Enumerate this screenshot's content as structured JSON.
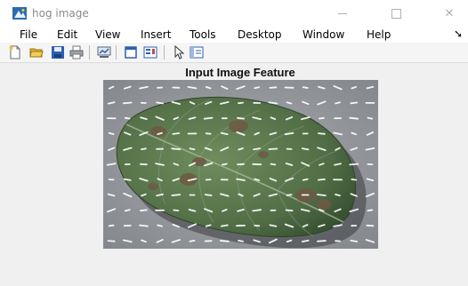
{
  "window": {
    "title": "hog image",
    "controls": {
      "minimize": "—",
      "maximize": "☐",
      "close": "✕"
    }
  },
  "menu": {
    "items": [
      {
        "label": "File"
      },
      {
        "label": "Edit"
      },
      {
        "label": "View"
      },
      {
        "label": "Insert"
      },
      {
        "label": "Tools"
      },
      {
        "label": "Desktop"
      },
      {
        "label": "Window"
      },
      {
        "label": "Help"
      }
    ],
    "overflow_arrow": "➘"
  },
  "toolbar": {
    "buttons": [
      "new-figure-icon",
      "open-file-icon",
      "save-icon",
      "print-icon",
      "link-plot-icon",
      "hide-plot-tools-icon",
      "insert-colorbar-icon",
      "edit-plot-icon",
      "show-plot-tools-icon"
    ]
  },
  "figure": {
    "title": "Input Image Feature",
    "image_description_icon": "leaf-image-with-hog-overlay"
  },
  "colors": {
    "leaf": "#5c7a4f",
    "background_paper": "#9a9ca0",
    "hog_marks": "#ffffff"
  }
}
